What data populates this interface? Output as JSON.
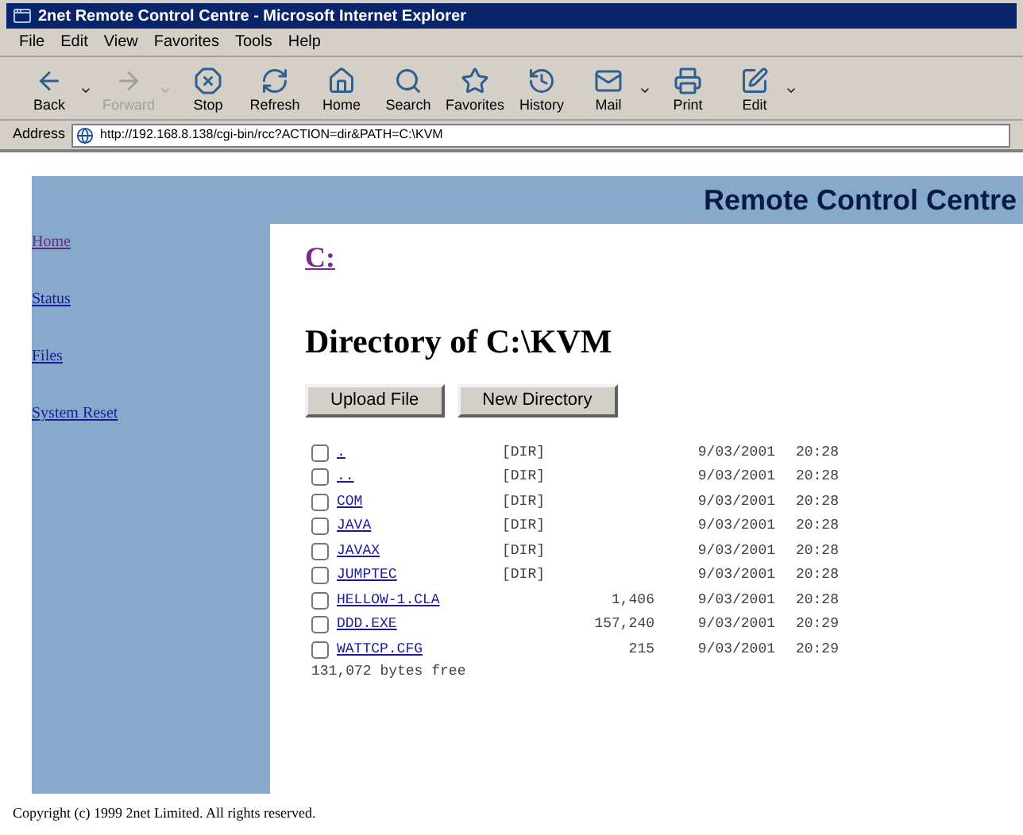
{
  "window": {
    "title": "2net Remote Control Centre - Microsoft Internet Explorer"
  },
  "menu": [
    "File",
    "Edit",
    "View",
    "Favorites",
    "Tools",
    "Help"
  ],
  "toolbar": [
    {
      "kind": "back",
      "label": "Back",
      "disabled": false,
      "dropdown": true
    },
    {
      "kind": "forward",
      "label": "Forward",
      "disabled": true,
      "dropdown": true
    },
    {
      "kind": "stop",
      "label": "Stop",
      "disabled": false,
      "dropdown": false
    },
    {
      "kind": "refresh",
      "label": "Refresh",
      "disabled": false,
      "dropdown": false
    },
    {
      "kind": "home",
      "label": "Home",
      "disabled": false,
      "dropdown": false
    },
    {
      "kind": "search",
      "label": "Search",
      "disabled": false,
      "dropdown": false
    },
    {
      "kind": "favorites",
      "label": "Favorites",
      "disabled": false,
      "dropdown": false
    },
    {
      "kind": "history",
      "label": "History",
      "disabled": false,
      "dropdown": false
    },
    {
      "kind": "mail",
      "label": "Mail",
      "disabled": false,
      "dropdown": true
    },
    {
      "kind": "print",
      "label": "Print",
      "disabled": false,
      "dropdown": false
    },
    {
      "kind": "edit",
      "label": "Edit",
      "disabled": false,
      "dropdown": true
    }
  ],
  "address": {
    "label": "Address",
    "value": "http://192.168.8.138/cgi-bin/rcc?ACTION=dir&PATH=C:\\KVM"
  },
  "page": {
    "banner": "Remote Control Centre",
    "sidebar": [
      {
        "label": "Home",
        "visited": true
      },
      {
        "label": "Status",
        "visited": false
      },
      {
        "label": "Files",
        "visited": false
      },
      {
        "label": "System Reset",
        "visited": false
      }
    ],
    "drive_link": "C:",
    "heading": "Directory of C:\\KVM",
    "buttons": [
      "Upload File",
      "New Directory"
    ],
    "files": [
      {
        "name": ".",
        "type": "[DIR]",
        "date": "9/03/2001",
        "time": "20:28",
        "checked": false
      },
      {
        "name": "..",
        "type": "[DIR]",
        "date": "9/03/2001",
        "time": "20:28",
        "checked": false
      },
      {
        "name": "COM",
        "type": "[DIR]",
        "date": "9/03/2001",
        "time": "20:28",
        "checked": false
      },
      {
        "name": "JAVA",
        "type": "[DIR]",
        "date": "9/03/2001",
        "time": "20:28",
        "checked": false
      },
      {
        "name": "JAVAX",
        "type": "[DIR]",
        "date": "9/03/2001",
        "time": "20:28",
        "checked": false
      },
      {
        "name": "JUMPTEC",
        "type": "[DIR]",
        "date": "9/03/2001",
        "time": "20:28",
        "checked": false
      },
      {
        "name": "HELLOW-1.CLA",
        "size": "1,406",
        "date": "9/03/2001",
        "time": "20:28",
        "checked": false
      },
      {
        "name": "DDD.EXE",
        "size": "157,240",
        "date": "9/03/2001",
        "time": "20:29",
        "checked": false
      },
      {
        "name": "WATTCP.CFG",
        "size": "215",
        "date": "9/03/2001",
        "time": "20:29",
        "checked": false
      }
    ],
    "free": "131,072 bytes free",
    "footer": "Copyright (c) 1999 2net Limited. All rights reserved."
  }
}
